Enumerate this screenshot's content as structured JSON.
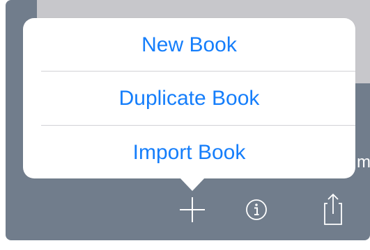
{
  "background": {
    "partial_text": "m"
  },
  "popover": {
    "items": [
      {
        "label": "New Book"
      },
      {
        "label": "Duplicate Book"
      },
      {
        "label": "Import Book"
      }
    ]
  },
  "toolbar": {
    "icons": [
      "plus-icon",
      "info-icon",
      "share-icon"
    ]
  },
  "colors": {
    "accent": "#157efb",
    "backdrop": "#717d8c",
    "background_card": "#c7c7cb",
    "popover": "#ffffff",
    "divider": "#d2d2d6"
  }
}
